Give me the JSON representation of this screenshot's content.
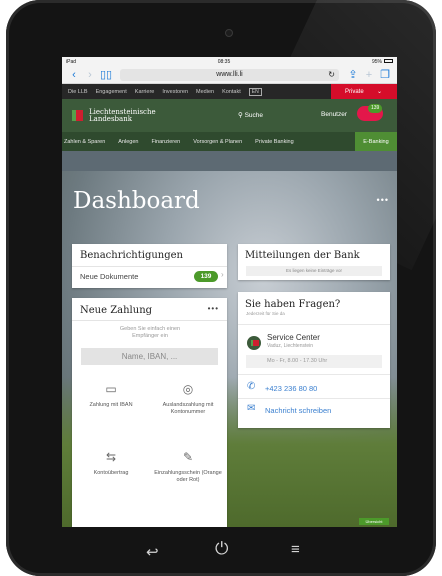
{
  "status": {
    "carrier": "iPad",
    "time": "08:35",
    "battery": "95%"
  },
  "browser": {
    "url": "www.lli.li"
  },
  "topmenu": {
    "items": [
      "Die LLB",
      "Engagement",
      "Karriere",
      "Investoren",
      "Medien",
      "Kontakt"
    ],
    "lang": "EN",
    "segment": "Private"
  },
  "header": {
    "brand_line1": "Liechtensteinische",
    "brand_line2": "Landesbank",
    "search_label": "Suche",
    "user_label": "Benutzer",
    "notification_count": "139"
  },
  "catnav": {
    "items": [
      "Zahlen & Sparen",
      "Anlegen",
      "Finanzieren",
      "Vorsorgen & Planen",
      "Private Banking"
    ],
    "active": "E-Banking"
  },
  "dashboard": {
    "title": "Dashboard",
    "more": "•••"
  },
  "notifications": {
    "title": "Benachrichtigungen",
    "row_label": "Neue Dokumente",
    "count": "139",
    "arrow": "›"
  },
  "bank_messages": {
    "title": "Mitteilungen der Bank",
    "empty_text": "Es liegen keine Einträge vor"
  },
  "payment": {
    "title": "Neue Zahlung",
    "more": "•••",
    "hint": "Geben Sie einfach einen Empfänger ein",
    "iban_placeholder": "Name, IBAN, ...",
    "options": [
      {
        "icon": "▭",
        "label": "Zahlung mit IBAN"
      },
      {
        "icon": "◎",
        "label": "Auslandszahlung mit Kontonummer"
      },
      {
        "icon": "⇆",
        "label": "Kontoübertrag"
      },
      {
        "icon": "✎",
        "label": "Einzahlungsschein (Orange oder Rot)"
      }
    ]
  },
  "questions": {
    "title": "Sie haben Fragen?",
    "subtitle": "Jederzeit für Sie da",
    "service_name": "Service Center",
    "service_address": "Vaduz, Liechtenstein",
    "hours": "Mo - Fr, 8.00 - 17.30 Uhr",
    "phone": "+423 236 80 80",
    "message_link": "Nachricht schreiben"
  },
  "overview_button": "Übersicht",
  "hardware": {
    "back": "↩",
    "power": "⏻",
    "menu": "≡"
  }
}
